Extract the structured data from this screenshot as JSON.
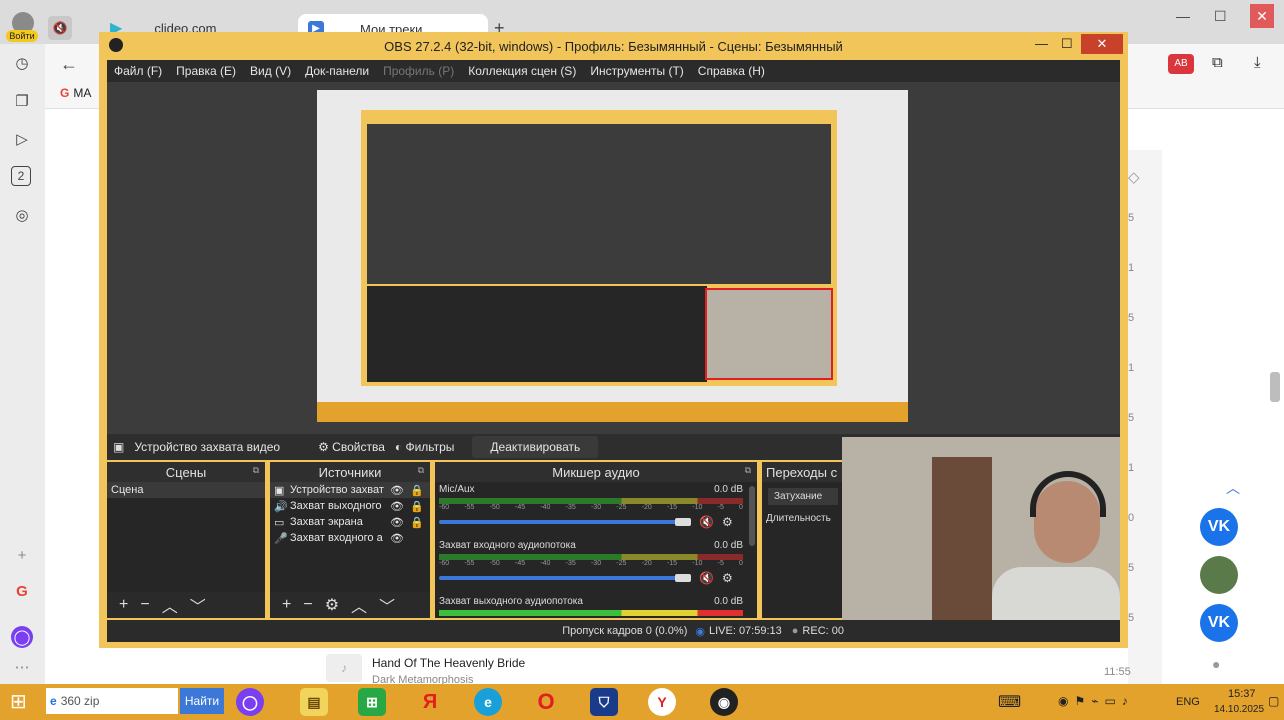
{
  "browser": {
    "tabs": [
      "clideo.com",
      "Мои треки"
    ],
    "login_label": "Войти",
    "bookmark_label": "MA",
    "left_badge": "2",
    "right_numbers": [
      "5",
      "1",
      "5",
      "1",
      "5",
      "1",
      "0",
      "5",
      "5"
    ],
    "track": {
      "title": "Hand Of The Heavenly Bride",
      "artist": "Dark Metamorphosis",
      "time": "11:55"
    }
  },
  "obs": {
    "title": "OBS 27.2.4 (32-bit, windows) - Профиль: Безымянный - Сцены: Безымянный",
    "menu": [
      "Файл (F)",
      "Правка (E)",
      "Вид (V)",
      "Док-панели",
      "Профиль (P)",
      "Коллекция сцен (S)",
      "Инструменты (T)",
      "Справка (H)"
    ],
    "source_toolbar": {
      "source_name": "Устройство захвата видео",
      "properties": "Свойства",
      "filters": "Фильтры",
      "deactivate": "Деактивировать"
    },
    "scenes": {
      "header": "Сцены",
      "items": [
        "Сцена"
      ]
    },
    "sources": {
      "header": "Источники",
      "items": [
        "Устройство захват",
        "Захват выходного",
        "Захват экрана",
        "Захват входного а"
      ]
    },
    "mixer": {
      "header": "Микшер аудио",
      "channels": [
        {
          "name": "Mic/Aux",
          "db": "0.0 dB"
        },
        {
          "name": "Захват входного аудиопотока",
          "db": "0.0 dB"
        },
        {
          "name": "Захват выходного аудиопотока",
          "db": "0.0 dB"
        }
      ],
      "ticks": [
        "-60",
        "-55",
        "-50",
        "-45",
        "-40",
        "-35",
        "-30",
        "-25",
        "-20",
        "-15",
        "-10",
        "-5",
        "0"
      ]
    },
    "transitions": {
      "header": "Переходы с",
      "fade": "Затухание",
      "duration": "Длительность"
    },
    "status": {
      "dropped": "Пропуск кадров 0 (0.0%)",
      "live": "LIVE: 07:59:13",
      "rec": "REC: 00"
    }
  },
  "taskbar": {
    "search_text": "360 zip",
    "search_button": "Найти",
    "lang": "ENG",
    "time": "15:37",
    "date": "14.10.2025"
  },
  "colors": {
    "obs_frame": "#f1c55a",
    "taskbar": "#e2a22c",
    "obs_dark": "#262626",
    "accent": "#3b78d8",
    "vk": "#1a73e8"
  }
}
